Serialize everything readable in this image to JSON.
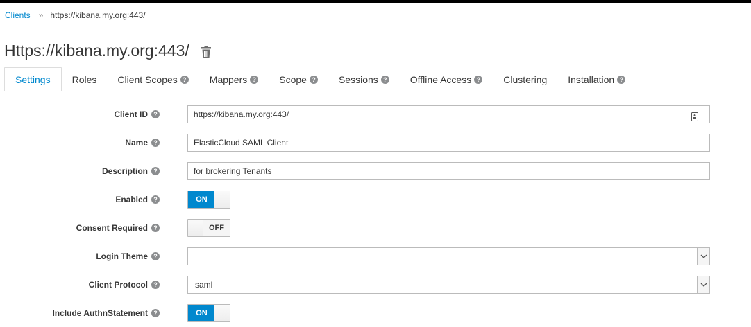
{
  "breadcrumb": {
    "parent": "Clients",
    "separator": "»",
    "current": "https://kibana.my.org:443/"
  },
  "title": "Https://kibana.my.org:443/",
  "title_icon": "trash-icon",
  "tabs": [
    {
      "label": "Settings",
      "active": true,
      "help": false
    },
    {
      "label": "Roles",
      "help": false
    },
    {
      "label": "Client Scopes",
      "help": true
    },
    {
      "label": "Mappers",
      "help": true
    },
    {
      "label": "Scope",
      "help": true
    },
    {
      "label": "Sessions",
      "help": true
    },
    {
      "label": "Offline Access",
      "help": true
    },
    {
      "label": "Clustering",
      "help": false
    },
    {
      "label": "Installation",
      "help": true
    }
  ],
  "form": {
    "client_id": {
      "label": "Client ID",
      "value": "https://kibana.my.org:443/"
    },
    "name": {
      "label": "Name",
      "value": "ElasticCloud SAML Client"
    },
    "description": {
      "label": "Description",
      "value": "for brokering Tenants"
    },
    "enabled": {
      "label": "Enabled",
      "state": "ON"
    },
    "consent_required": {
      "label": "Consent Required",
      "state": "OFF"
    },
    "login_theme": {
      "label": "Login Theme",
      "value": ""
    },
    "client_protocol": {
      "label": "Client Protocol",
      "value": "saml"
    },
    "include_authn": {
      "label": "Include AuthnStatement",
      "state": "ON"
    }
  },
  "help_glyph": "?",
  "colors": {
    "accent": "#0088ce",
    "text": "#363636",
    "border": "#bbbbbb"
  }
}
